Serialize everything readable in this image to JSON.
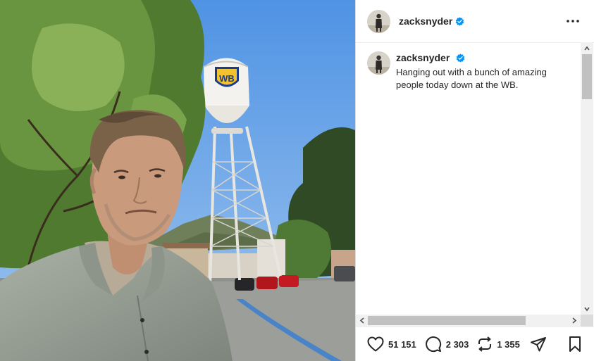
{
  "post": {
    "username": "zacksnyder",
    "verified": true,
    "caption": "Hanging out with a bunch of amazing people today down at the WB.",
    "photo_logo_text": "WB"
  },
  "icons": {
    "verified": "verified-badge-icon",
    "more": "more-options-icon",
    "like": "heart-icon",
    "comment": "comment-bubble-icon",
    "repost": "repost-icon",
    "share": "paper-plane-icon",
    "save": "bookmark-icon"
  },
  "actions": {
    "likes": "51 151",
    "comments": "2 303",
    "reposts": "1 355"
  },
  "colors": {
    "verified_blue": "#0095f6",
    "text": "#262626",
    "sky": "#5a9ce8"
  }
}
